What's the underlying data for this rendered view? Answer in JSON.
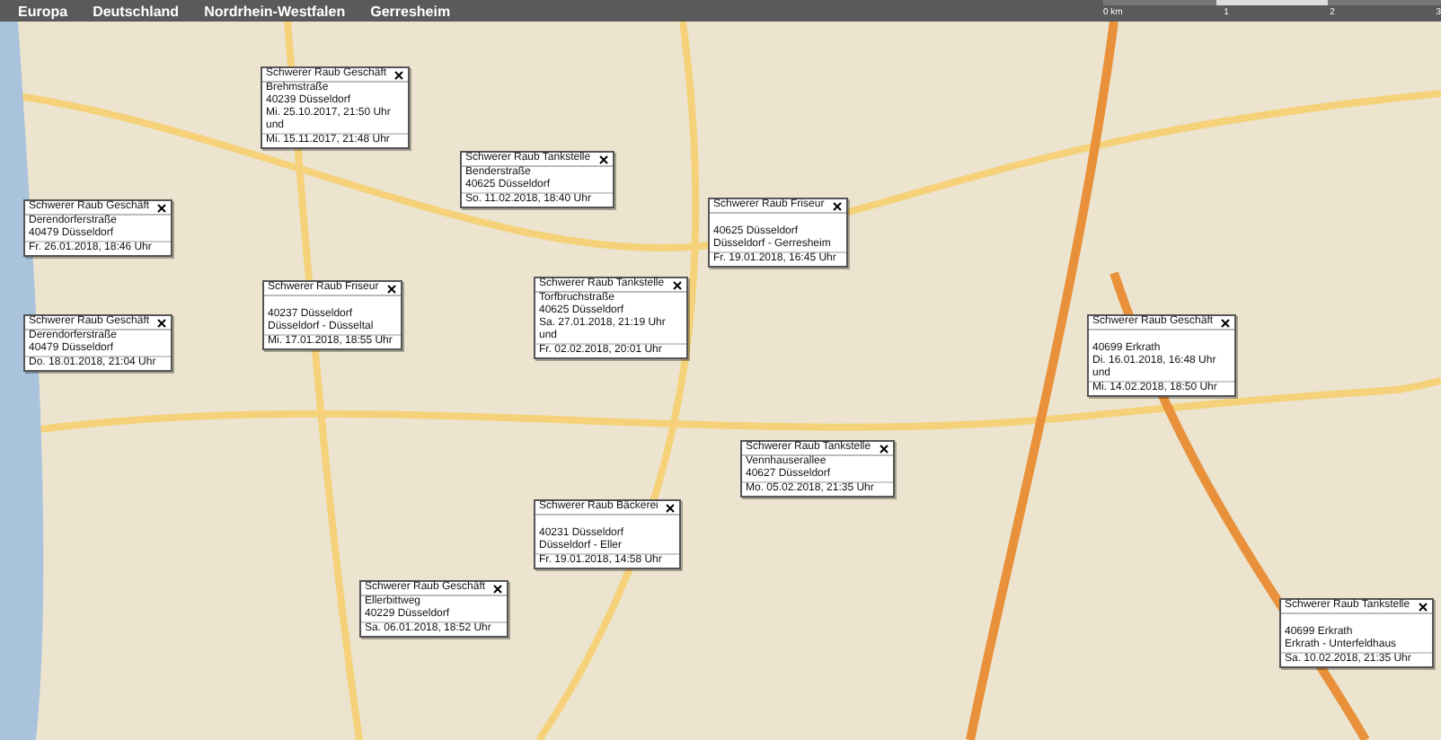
{
  "breadcrumbs": [
    "Europa",
    "Deutschland",
    "Nordrhein-Westfalen",
    "Gerresheim"
  ],
  "scale": {
    "labels": [
      "0 km",
      "1",
      "2",
      "3"
    ]
  },
  "popups": [
    {
      "title": "Schwerer Raub Geschäft",
      "blank_line": false,
      "lines": [
        "Brehmstraße",
        "40239 Düsseldorf",
        "Mi. 25.10.2017, 21:50 Uhr",
        "und",
        "Mi. 15.11.2017, 21:48 Uhr"
      ]
    },
    {
      "title": "Schwerer Raub Tankstelle",
      "blank_line": false,
      "lines": [
        "Benderstraße",
        "40625 Düsseldorf",
        "So. 11.02.2018, 18:40 Uhr"
      ]
    },
    {
      "title": "Schwerer Raub Geschäft",
      "blank_line": false,
      "lines": [
        "Derendorferstraße",
        "40479 Düsseldorf",
        "Fr. 26.01.2018, 18:46 Uhr"
      ]
    },
    {
      "title": "Schwerer Raub Friseur",
      "blank_line": true,
      "lines": [
        "40625 Düsseldorf",
        "Düsseldorf - Gerresheim",
        "Fr. 19.01.2018, 16:45 Uhr"
      ]
    },
    {
      "title": "Schwerer Raub Friseur",
      "blank_line": true,
      "lines": [
        "40237 Düsseldorf",
        "Düsseldorf - Düsseltal",
        "Mi. 17.01.2018, 18:55 Uhr"
      ]
    },
    {
      "title": "Schwerer Raub Tankstelle",
      "blank_line": false,
      "lines": [
        "Torfbruchstraße",
        "40625 Düsseldorf",
        "Sa. 27.01.2018, 21:19 Uhr",
        "und",
        "Fr. 02.02.2018, 20:01 Uhr"
      ]
    },
    {
      "title": "Schwerer Raub Geschäft",
      "blank_line": false,
      "lines": [
        "Derendorferstraße",
        "40479 Düsseldorf",
        "Do. 18.01.2018, 21:04 Uhr"
      ]
    },
    {
      "title": "Schwerer Raub Geschäft",
      "blank_line": true,
      "lines": [
        "40699 Erkrath",
        "Di. 16.01.2018, 16:48 Uhr",
        "und",
        "Mi. 14.02.2018, 18:50 Uhr"
      ]
    },
    {
      "title": "Schwerer Raub Tankstelle",
      "blank_line": false,
      "lines": [
        "Vennhauserallee",
        "40627 Düsseldorf",
        "Mo. 05.02.2018, 21:35 Uhr"
      ]
    },
    {
      "title": "Schwerer Raub Bäckerei",
      "blank_line": true,
      "lines": [
        "40231 Düsseldorf",
        "Düsseldorf - Eller",
        "Fr. 19.01.2018, 14:58 Uhr"
      ]
    },
    {
      "title": "Schwerer Raub Geschäft",
      "blank_line": false,
      "lines": [
        "Ellerbittweg",
        "40229 Düsseldorf",
        "Sa. 06.01.2018, 18:52 Uhr"
      ]
    },
    {
      "title": "Schwerer Raub Tankstelle",
      "blank_line": true,
      "lines": [
        "40699 Erkrath",
        "Erkrath - Unterfeldhaus",
        "Sa. 10.02.2018, 21:35 Uhr"
      ]
    }
  ]
}
